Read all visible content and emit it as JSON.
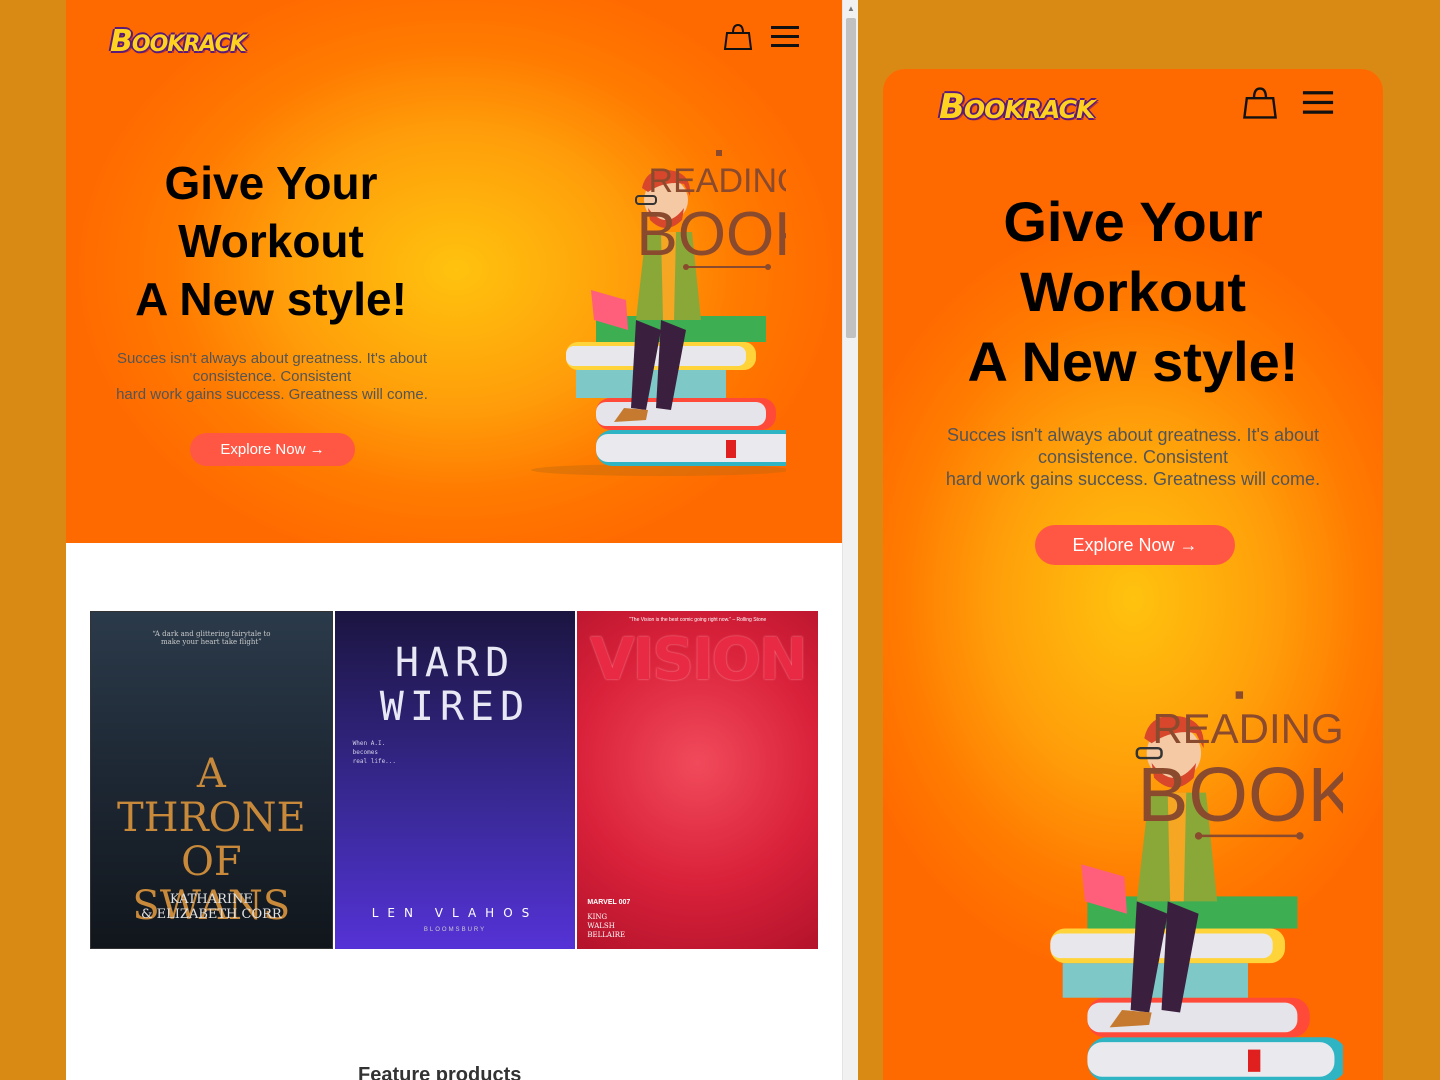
{
  "brand": {
    "logo_first": "B",
    "logo_rest": "OOKRACK"
  },
  "hero": {
    "title_line1": "Give Your",
    "title_line2": "Workout",
    "title_line3": "A New style!",
    "text_line1": "Succes isn't always about greatness. It's about",
    "text_line2": "consistence. Consistent",
    "text_line3": "hard work gains success. Greatness will come.",
    "cta": "Explore Now →"
  },
  "illustration": {
    "line1": "READING",
    "line2": "BOOK"
  },
  "books": [
    {
      "quote": "“A dark and glittering fairytale to make your heart take flight”",
      "title_a": "A",
      "title_b": "THRONE",
      "title_c": "OF",
      "title_d": "SWANS",
      "author_1": "KATHARINE",
      "author_2": "& ELIZABETH CORR"
    },
    {
      "title_1": "HARD",
      "title_2": "WIRED",
      "sub_1": "When A.I.",
      "sub_2": "becomes",
      "sub_3": "real life...",
      "author": "LEN VLAHOS",
      "publisher": "BLOOMSBURY"
    },
    {
      "quote": "“The Vision is the best comic going right now.” – Rolling Stone",
      "title": "VISION",
      "imprint": "MARVEL 007",
      "creator_1": "KING",
      "creator_2": "WALSH",
      "creator_3": "BELLAIRE"
    }
  ],
  "sections": {
    "feature_heading": "Feature products"
  },
  "icons": {
    "cart": "shopping-bag-icon",
    "menu": "hamburger-menu-icon"
  },
  "colors": {
    "accent": "#ff5744",
    "hero_orange": "#ff7a00",
    "hero_yellow": "#ffc20e",
    "background": "#d98a14"
  }
}
